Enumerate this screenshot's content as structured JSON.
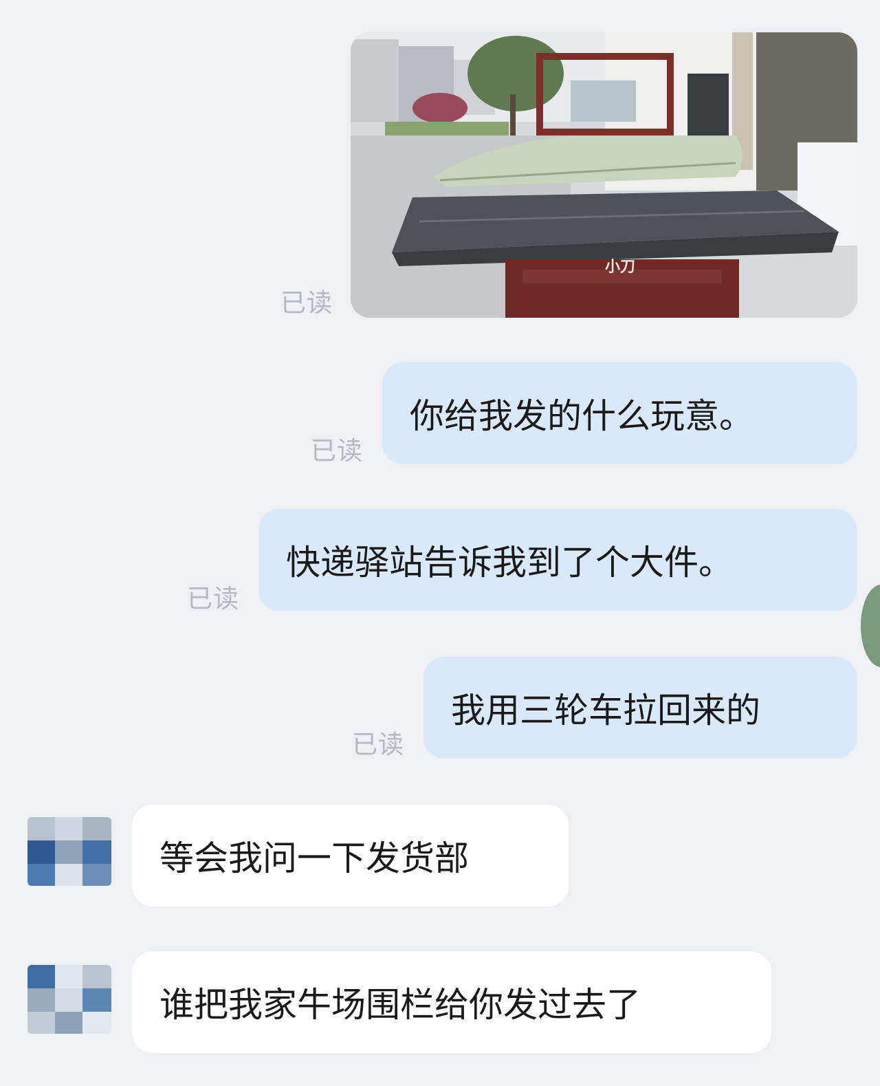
{
  "read_label": "已读",
  "messages": [
    {
      "side": "out",
      "type": "image",
      "image_description": "tricycle-with-large-package"
    },
    {
      "side": "out",
      "type": "text",
      "text": "你给我发的什么玩意。"
    },
    {
      "side": "out",
      "type": "text",
      "text": "快递驿站告诉我到了个大件。"
    },
    {
      "side": "out",
      "type": "text",
      "text": "我用三轮车拉回来的"
    },
    {
      "side": "in",
      "type": "text",
      "text": "等会我问一下发货部"
    },
    {
      "side": "in",
      "type": "text",
      "text": "谁把我家牛场围栏给你发过去了"
    }
  ],
  "photo_sign_text": "小刀",
  "colors": {
    "background": "#eef0f4",
    "outgoing_bubble": "#d9e9f9",
    "incoming_bubble": "#ffffff",
    "read_receipt": "#b6b8bd"
  }
}
